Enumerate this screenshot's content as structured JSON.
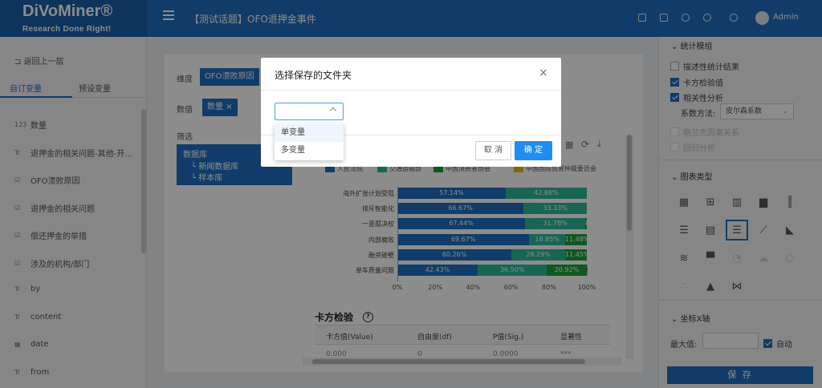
{
  "header": {
    "logo_name": "DiVoMiner®",
    "logo_tagline": "Research Done Right!",
    "project_title": "【测试话题】OFO退押金事件",
    "user": "Admin"
  },
  "left": {
    "back": "返回上一层",
    "tabs": [
      "自订变量",
      "预设变量"
    ],
    "variables": [
      {
        "icon": "123",
        "label": "数量"
      },
      {
        "icon": "Tr",
        "label": "退押金的相关问题-其他-开..."
      },
      {
        "icon": "☑",
        "label": "OFO溃败原因"
      },
      {
        "icon": "☑",
        "label": "退押金的相关问题"
      },
      {
        "icon": "☑",
        "label": "偿还押金的举措"
      },
      {
        "icon": "☑",
        "label": "涉及的机构/部门"
      },
      {
        "icon": "Tr",
        "label": "by"
      },
      {
        "icon": "Tr",
        "label": "content"
      },
      {
        "icon": "▦",
        "label": "date"
      },
      {
        "icon": "Tr",
        "label": "from"
      }
    ]
  },
  "center": {
    "dimension_label": "维度",
    "dimension_chip": "OFO溃败原因",
    "value_label": "数值",
    "value_chip": "数量",
    "filter_label": "筛选",
    "filter_tree": {
      "root": "数据库",
      "children": [
        "新闻数据库",
        "样本库"
      ]
    },
    "chi_title": "卡方检验",
    "chi_headers": [
      "卡方值(Value)",
      "自由度(df)",
      "P值(Sig.)",
      "显著性"
    ],
    "chi_row": [
      "0.000",
      "0",
      "0.0000",
      "***"
    ]
  },
  "chart_data": {
    "type": "bar",
    "orientation": "horizontal",
    "stacked": "percent",
    "categories": [
      "海外扩张计划受阻",
      "排斥智能化",
      "一意孤决权",
      "内部腐败",
      "融资碰壁",
      "单车质量问题"
    ],
    "series": [
      {
        "name": "人民法院",
        "color": "#1f6ec0",
        "values": [
          57.14,
          66.67,
          67.44,
          69.67,
          60.26,
          42.43
        ]
      },
      {
        "name": "交通运输部",
        "color": "#2db89a",
        "values": [
          42.86,
          33.33,
          31.78,
          18.85,
          28.29,
          36.5
        ]
      },
      {
        "name": "中国消费者协会",
        "color": "#1e9e3a",
        "values": [
          0,
          0,
          0.78,
          11.48,
          11.45,
          20.92
        ]
      },
      {
        "name": "中国国际贸易仲裁委员会",
        "color": "#e5c21a",
        "values": [
          0,
          0,
          0,
          0,
          0,
          0.15
        ]
      }
    ],
    "value_labels": [
      [
        "57.14%",
        "42.86%",
        "",
        ""
      ],
      [
        "66.67%",
        "33.33%",
        "",
        ""
      ],
      [
        "67.44%",
        "31.78%",
        "0.78%",
        ""
      ],
      [
        "69.67%",
        "18.85%",
        "11.48%",
        ""
      ],
      [
        "60.26%",
        "28.29%",
        "11.45%",
        ""
      ],
      [
        "42.43%",
        "36.50%",
        "20.92%",
        "0.15%"
      ]
    ],
    "xticks": [
      "0%",
      "20%",
      "40%",
      "60%",
      "80%",
      "100%"
    ],
    "xlim": [
      0,
      100
    ],
    "legend_position": "top"
  },
  "right": {
    "stats_title": "统计模组",
    "stats_options": [
      {
        "label": "描述性统计结果",
        "checked": false,
        "enabled": true
      },
      {
        "label": "卡方检验值",
        "checked": true,
        "enabled": true
      },
      {
        "label": "相关性分析",
        "checked": true,
        "enabled": true
      }
    ],
    "method_label": "系数方法:",
    "method_value": "皮尔森系数",
    "disabled_options": [
      "格兰杰因果关系",
      "回归分析"
    ],
    "chart_type_title": "图表类型",
    "axis_title": "坐标X轴",
    "max_label": "最大值:",
    "auto_label": "自动",
    "save_label": "保 存"
  },
  "modal": {
    "title": "选择保存的文件夹",
    "select_value": "",
    "options": [
      "单变量",
      "多变量"
    ],
    "cancel": "取 消",
    "ok": "确 定"
  }
}
